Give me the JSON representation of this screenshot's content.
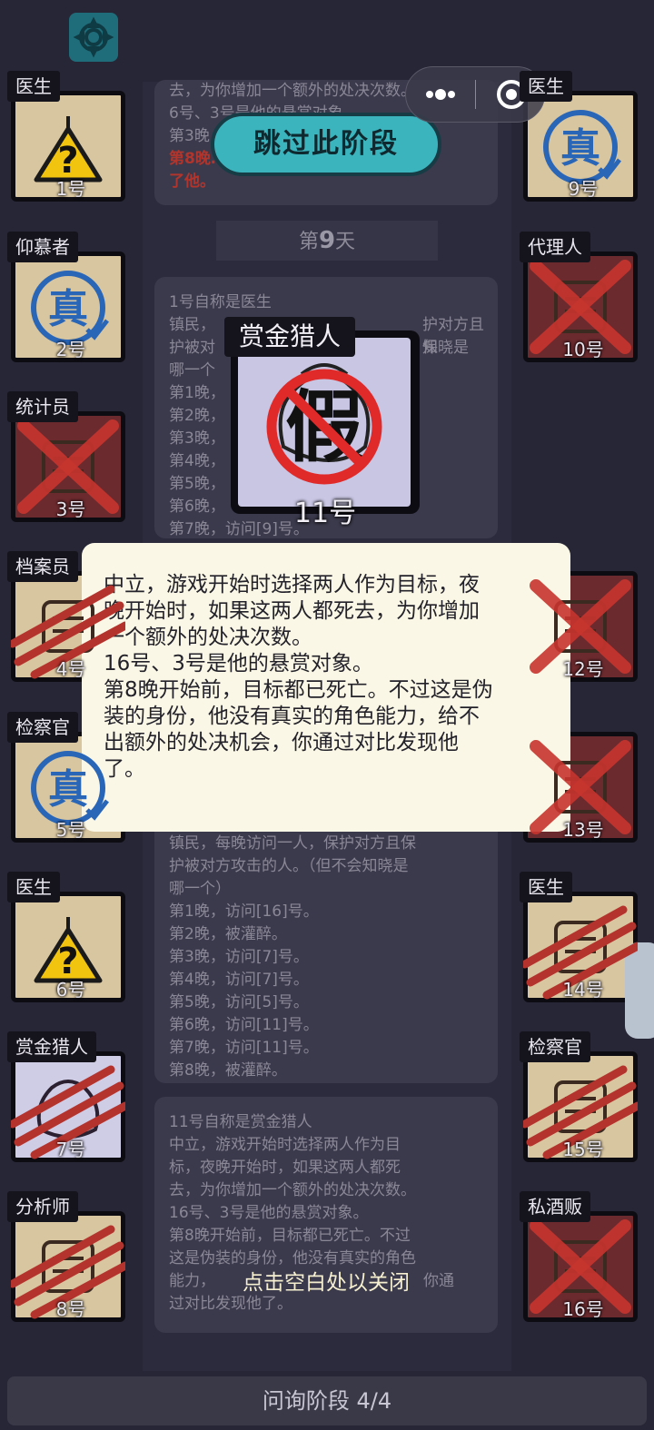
{
  "phase_skip_label": "跳过此阶段",
  "day_banner": {
    "prefix": "第",
    "day": "9",
    "suffix": "天"
  },
  "left_players": [
    {
      "role": "医生",
      "num": "1号",
      "icon": "question-flask-icon",
      "state": "alive"
    },
    {
      "role": "仰慕者",
      "num": "2号",
      "icon": "true-stamp-icon",
      "state": "alive"
    },
    {
      "role": "统计员",
      "num": "3号",
      "icon": "typewriter-icon",
      "state": "dead-x"
    },
    {
      "role": "档案员",
      "num": "4号",
      "icon": "archive-icon",
      "state": "clawed"
    },
    {
      "role": "检察官",
      "num": "5号",
      "icon": "true-stamp-icon",
      "state": "alive"
    },
    {
      "role": "医生",
      "num": "6号",
      "icon": "question-flask-icon",
      "state": "alive"
    },
    {
      "role": "赏金猎人",
      "num": "7号",
      "icon": "money-bag-icon",
      "state": "clawed"
    },
    {
      "role": "分析师",
      "num": "8号",
      "icon": "analyst-icon",
      "state": "clawed"
    }
  ],
  "right_players": [
    {
      "role": "医生",
      "num": "9号",
      "icon": "true-stamp-icon",
      "state": "alive"
    },
    {
      "role": "代理人",
      "num": "10号",
      "icon": "agent-icon",
      "state": "dead-x"
    },
    {
      "role": "",
      "num": "12号",
      "icon": "scale-icon",
      "state": "dead-x"
    },
    {
      "role": "",
      "num": "13号",
      "icon": "unknown-icon",
      "state": "dead-x"
    },
    {
      "role": "医生",
      "num": "14号",
      "icon": "flask-icon",
      "state": "clawed"
    },
    {
      "role": "检察官",
      "num": "15号",
      "icon": "scale-icon",
      "state": "clawed"
    },
    {
      "role": "私酒贩",
      "num": "16号",
      "icon": "bootlegger-icon",
      "state": "dead-x"
    }
  ],
  "log_top": {
    "lines": [
      "去，为你增加一个额外的处决次数。",
      "6号、3号是他的悬赏对象。",
      "第3晚…"
    ],
    "red_lines": [
      "第8晚…",
      "了他。"
    ]
  },
  "log_mid": {
    "lines": [
      "1号自称是医生",
      "镇民，",
      "护被对",
      "哪一个",
      "第1晚，",
      "第2晚，",
      "第3晚，",
      "第4晚，",
      "第5晚，",
      "第6晚，",
      "第7晚，访问[9]号。"
    ],
    "right_fragments": [
      "护对方且保",
      "知晓是"
    ]
  },
  "log_lower": {
    "lines": [
      "镇民，每晚访问一人，保护对方且保",
      "护被对方攻击的人。（但不会知晓是",
      "哪一个）",
      "第1晚，访问[16]号。",
      "第2晚，被灌醉。",
      "第3晚，访问[7]号。",
      "第4晚，访问[7]号。",
      "第5晚，访问[5]号。",
      "第6晚，访问[11]号。",
      "第7晚，访问[11]号。",
      "第8晚，被灌醉。"
    ]
  },
  "log_bottom": {
    "lines": [
      "11号自称是赏金猎人",
      "中立，游戏开始时选择两人作为目",
      "标，夜晚开始时，如果这两人都死",
      "去，为你增加一个额外的处决次数。",
      "16号、3号是他的悬赏对象。",
      "第8晚开始前，目标都已死亡。不过",
      "这是伪装的身份，他没有真实的角色",
      "能力，",
      "过对比发现他了。"
    ],
    "right_fragment": "你通"
  },
  "popup": {
    "role": "赏金猎人",
    "num": "11号",
    "icon": "fake-stamp-icon",
    "lines": [
      "中立，游戏开始时选择两人作为目标，夜",
      "晚开始时，如果这两人都死去，为你增加",
      "一个额外的处决次数。",
      "16号、3号是他的悬赏对象。",
      "第8晚开始前，目标都已死亡。不过这是伪",
      "装的身份，他没有真实的角色能力，给不",
      "出额外的处决机会，你通过对比发现他",
      "了。"
    ]
  },
  "close_hint": "点击空白处以关闭",
  "footer": "问询阶段 4/4",
  "colors": {
    "background": "#272636",
    "accent": "#3cb4be",
    "popup_bg": "#fbf7e6",
    "dead_red": "#c0392b"
  }
}
